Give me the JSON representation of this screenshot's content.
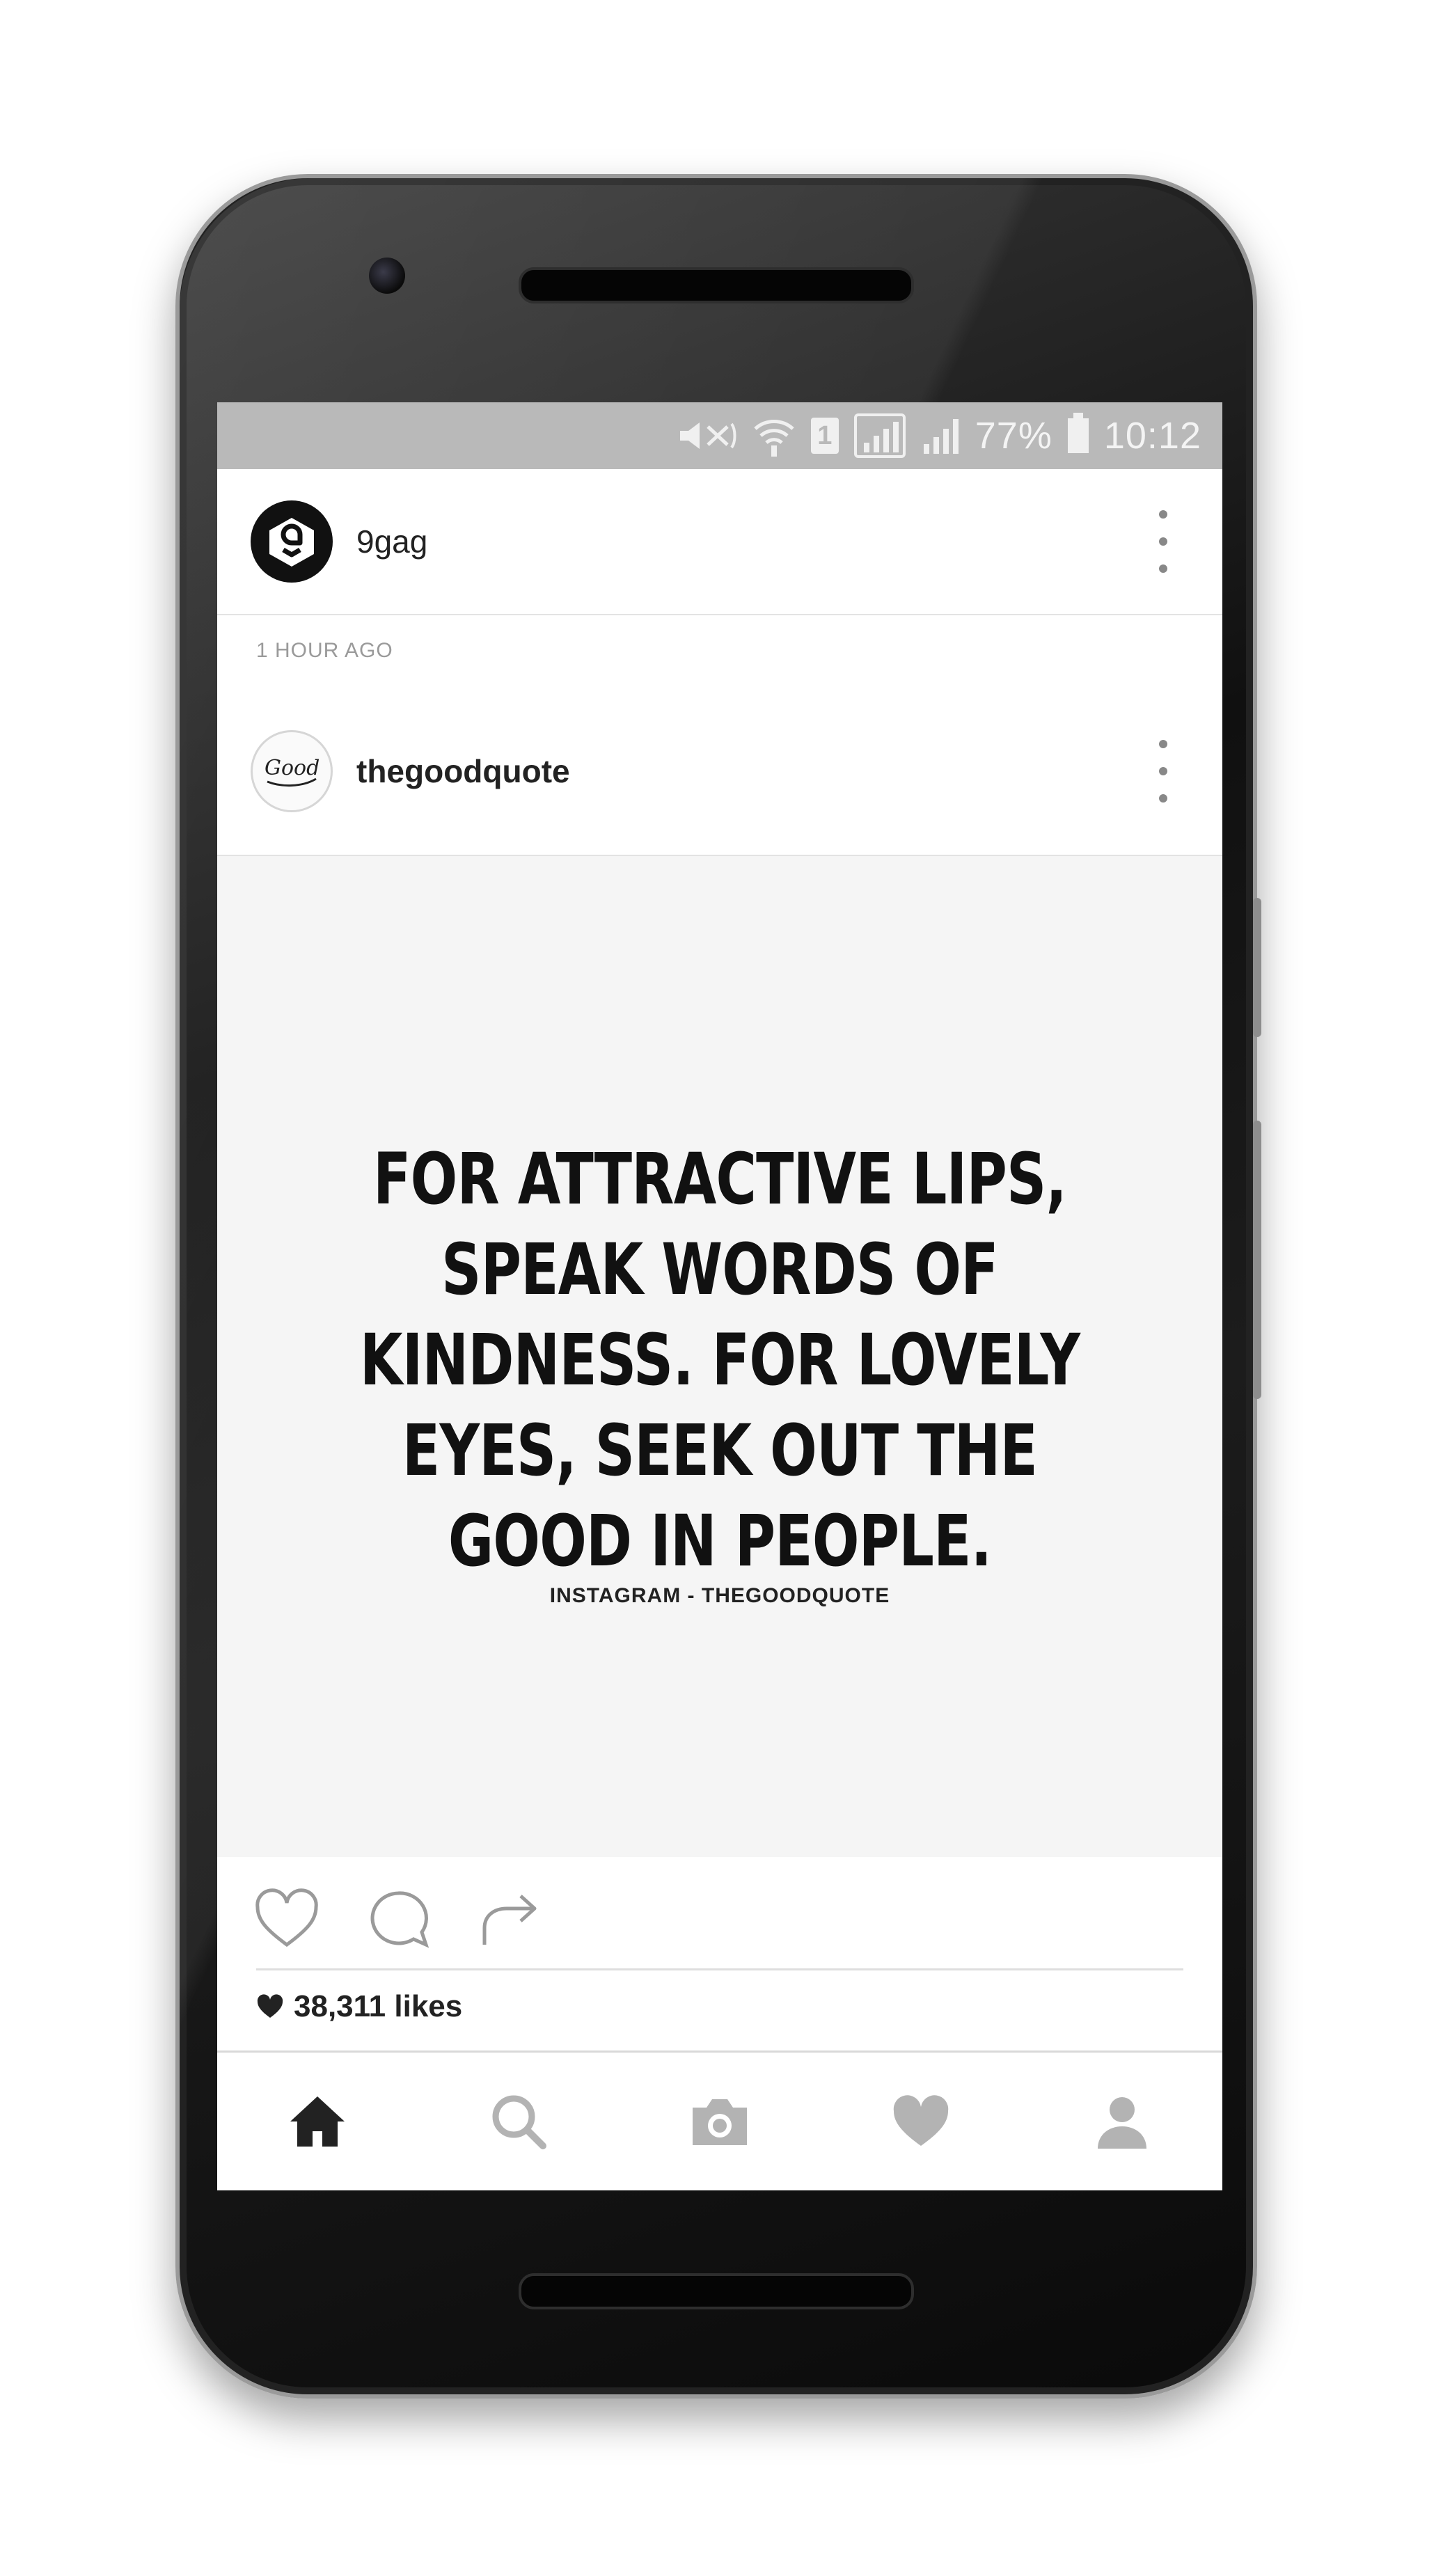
{
  "status_bar": {
    "sim_slot": "1",
    "battery": "77%",
    "time": "10:12"
  },
  "feed": {
    "account": {
      "username": "9gag"
    },
    "timestamp": "1 HOUR AGO",
    "post": {
      "username": "thegoodquote",
      "quote_lines": [
        "FOR ATTRACTIVE LIPS,",
        "SPEAK WORDS OF",
        "KINDNESS. FOR LOVELY",
        "EYES, SEEK OUT THE",
        "GOOD IN PEOPLE."
      ],
      "watermark": "INSTAGRAM - THEGOODQUOTE",
      "likes": "38,311 likes"
    }
  },
  "nav": {
    "items": [
      "home-icon",
      "search-icon",
      "camera-icon",
      "heart-icon",
      "profile-icon"
    ],
    "active": "home-icon"
  },
  "colors": {
    "status_bar_bg": "#b9b9b9",
    "image_bg": "#f5f5f5",
    "icon_inactive": "#b3b3b3",
    "icon_active": "#222222"
  }
}
